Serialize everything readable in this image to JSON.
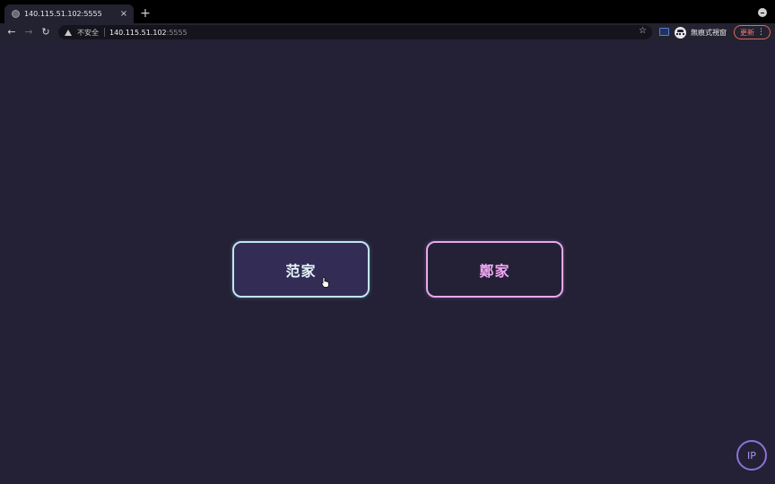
{
  "browser": {
    "tab": {
      "title": "140.115.51.102:5555",
      "close": "×",
      "favicon": "globe-icon"
    },
    "new_tab": "+",
    "nav": {
      "back": "←",
      "forward": "→",
      "reload": "↻"
    },
    "omnibox": {
      "security_label": "不安全",
      "host": "140.115.51.102",
      "port": ":5555"
    },
    "bookmark_star": "☆",
    "incognito_label": "無痕式視窗",
    "update_label": "更新",
    "menu": "⋮"
  },
  "page": {
    "choices": [
      {
        "label": "范家",
        "border_color": "#bfe6f2",
        "text_color": "#e6f6fb"
      },
      {
        "label": "鄭家",
        "border_color": "#e7a8ef",
        "text_color": "#f2a8f4"
      }
    ],
    "ip_button": "IP",
    "background": "#242136"
  }
}
